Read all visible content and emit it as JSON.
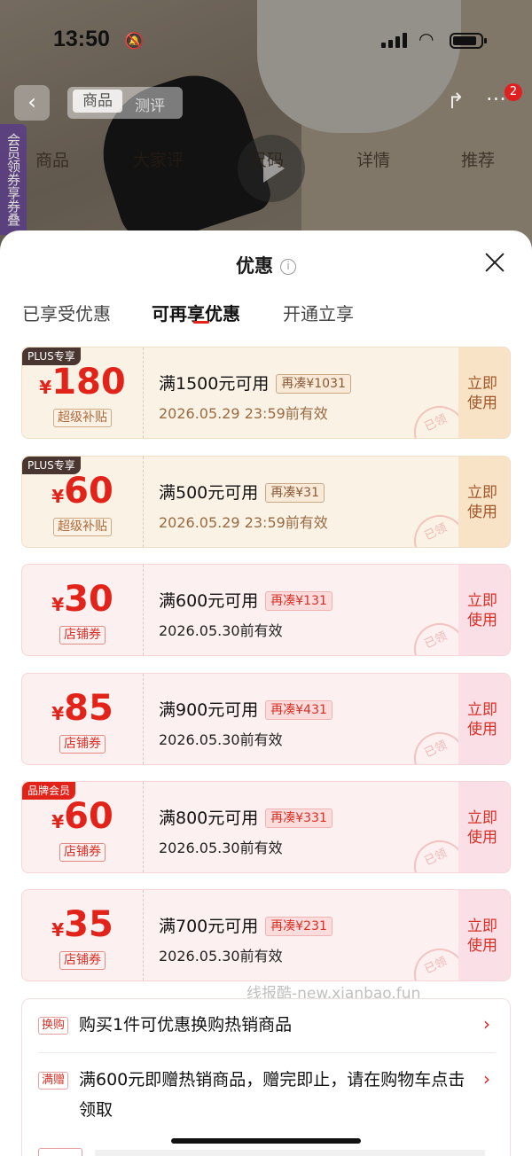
{
  "status_bar": {
    "time": "13:50"
  },
  "product_nav": {
    "seg_product": "商品",
    "seg_review": "测评",
    "cart_badge": "2",
    "anchors": [
      "商品",
      "大家评",
      "尺码",
      "详情",
      "推荐"
    ],
    "side_tag": "会员领券享券叠"
  },
  "sheet": {
    "title": "优惠",
    "tabs": [
      "已享受优惠",
      "可再享优惠",
      "开通立享"
    ],
    "active_tab": "可再享优惠"
  },
  "coupons": [
    {
      "style": "plus",
      "tag": "PLUS专享",
      "currency": "¥",
      "amount": "180",
      "type": "超级补贴",
      "condition": "满1500元可用",
      "more": "再凑¥1031",
      "valid": "2026.05.29 23:59前有效",
      "action": "立即使用",
      "stamp": "已领"
    },
    {
      "style": "plus",
      "tag": "PLUS专享",
      "currency": "¥",
      "amount": "60",
      "type": "超级补贴",
      "condition": "满500元可用",
      "more": "再凑¥31",
      "valid": "2026.05.29 23:59前有效",
      "action": "立即使用",
      "stamp": "已领"
    },
    {
      "style": "shop",
      "tag": "",
      "currency": "¥",
      "amount": "30",
      "type": "店铺券",
      "condition": "满600元可用",
      "more": "再凑¥131",
      "valid": "2026.05.30前有效",
      "action": "立即使用",
      "stamp": "已领"
    },
    {
      "style": "shop",
      "tag": "",
      "currency": "¥",
      "amount": "85",
      "type": "店铺券",
      "condition": "满900元可用",
      "more": "再凑¥431",
      "valid": "2026.05.30前有效",
      "action": "立即使用",
      "stamp": "已领"
    },
    {
      "style": "shop",
      "tag": "品牌会员",
      "currency": "¥",
      "amount": "60",
      "type": "店铺券",
      "condition": "满800元可用",
      "more": "再凑¥331",
      "valid": "2026.05.30前有效",
      "action": "立即使用",
      "stamp": "已领"
    },
    {
      "style": "shop",
      "tag": "",
      "currency": "¥",
      "amount": "35",
      "type": "店铺券",
      "condition": "满700元可用",
      "more": "再凑¥231",
      "valid": "2026.05.30前有效",
      "action": "立即使用",
      "stamp": "已领"
    }
  ],
  "watermark": "线报酷-new.xianbao.fun",
  "promotions": [
    {
      "tag": "换购",
      "text": "购买1件可优惠换购热销商品"
    },
    {
      "tag": "满赠",
      "text": "满600元即赠热销商品，赠完即止，请在购物车点击领取"
    }
  ],
  "colors": {
    "accent": "#e2231a",
    "plus_bg": "#fbf2e6",
    "shop_bg": "#fdf0f0"
  }
}
